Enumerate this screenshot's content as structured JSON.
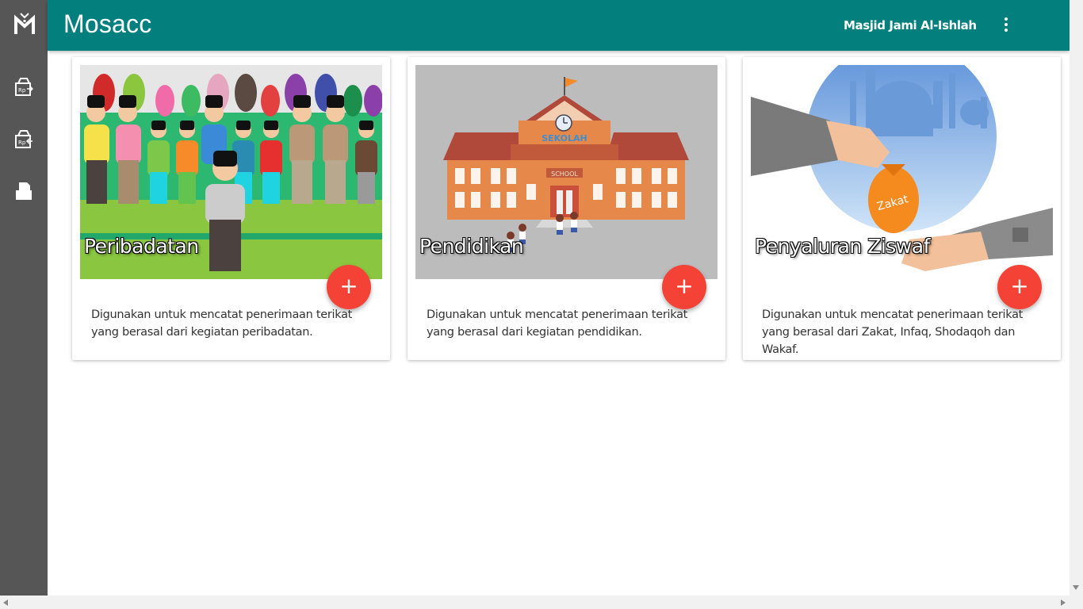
{
  "app": {
    "title": "Mosacc",
    "mosque_name": "Masjid Jami Al-Ishlah"
  },
  "sidebar": {
    "items": [
      {
        "name": "income-icon"
      },
      {
        "name": "expense-icon"
      },
      {
        "name": "report-icon"
      }
    ]
  },
  "cards": [
    {
      "title": "Peribadatan",
      "description": "Digunakan untuk mencatat penerimaan terikat yang berasal dari kegiatan peribadatan.",
      "button": "+"
    },
    {
      "title": "Pendidikan",
      "description": "Digunakan untuk mencatat penerimaan terikat yang berasal dari kegiatan pendidikan.",
      "button": "+",
      "image_text": {
        "sign": "SEKOLAH",
        "plate": "SCHOOL"
      }
    },
    {
      "title": "Penyaluran Ziswaf",
      "description": "Digunakan untuk mencatat penerimaan terikat yang berasal dari Zakat, Infaq, Shodaqoh dan Wakaf.",
      "button": "+",
      "image_text": {
        "bag": "Zakat"
      }
    }
  ],
  "colors": {
    "topbar": "#037f7e",
    "sidebar": "#565656",
    "fab": "#f44336"
  }
}
